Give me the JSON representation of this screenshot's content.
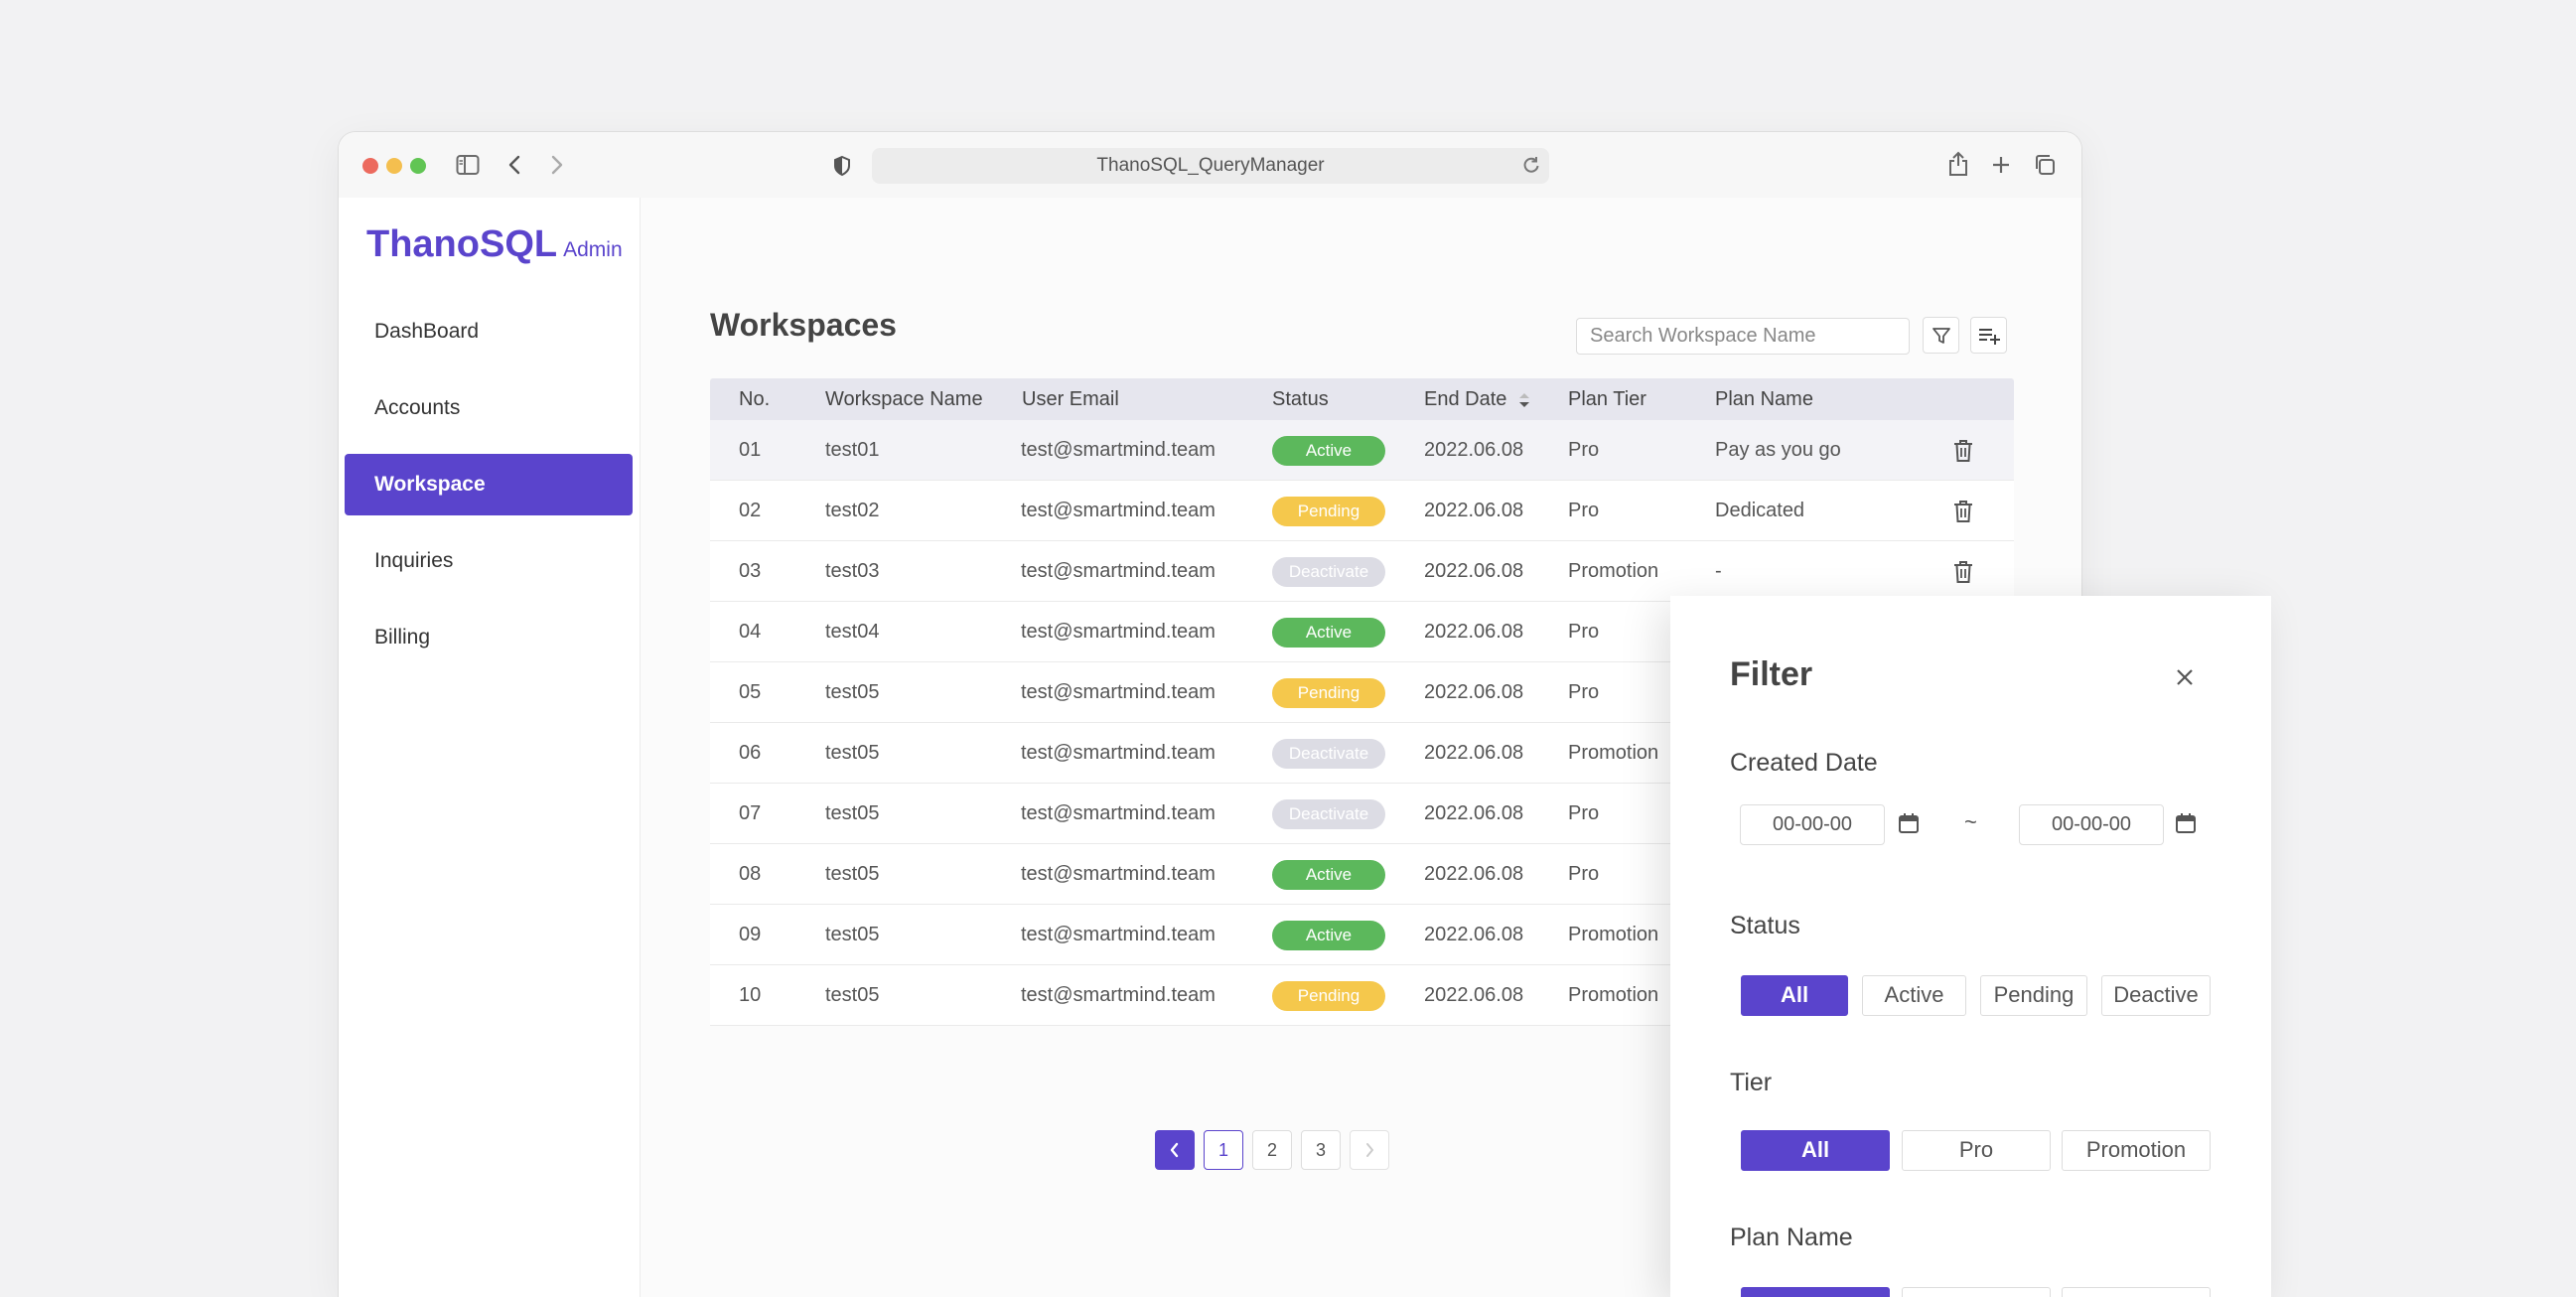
{
  "browser": {
    "url": "ThanoSQL_QueryManager"
  },
  "logo": {
    "main": "ThanoSQL",
    "sub": "Admin"
  },
  "sidebar": {
    "items": [
      {
        "label": "DashBoard"
      },
      {
        "label": "Accounts"
      },
      {
        "label": "Workspace"
      },
      {
        "label": "Inquiries"
      },
      {
        "label": "Billing"
      }
    ],
    "active": "Workspace"
  },
  "page": {
    "title": "Workspaces",
    "search_placeholder": "Search Workspace Name"
  },
  "table": {
    "headers": {
      "no": "No.",
      "name": "Workspace Name",
      "email": "User Email",
      "status": "Status",
      "end_date": "End Date",
      "tier": "Plan Tier",
      "plan": "Plan Name"
    },
    "rows": [
      {
        "no": "01",
        "name": "test01",
        "email": "test@smartmind.team",
        "status": "Active",
        "end_date": "2022.06.08",
        "tier": "Pro",
        "plan": "Pay as you go"
      },
      {
        "no": "02",
        "name": "test02",
        "email": "test@smartmind.team",
        "status": "Pending",
        "end_date": "2022.06.08",
        "tier": "Pro",
        "plan": "Dedicated"
      },
      {
        "no": "03",
        "name": "test03",
        "email": "test@smartmind.team",
        "status": "Deactivate",
        "end_date": "2022.06.08",
        "tier": "Promotion",
        "plan": "-"
      },
      {
        "no": "04",
        "name": "test04",
        "email": "test@smartmind.team",
        "status": "Active",
        "end_date": "2022.06.08",
        "tier": "Pro",
        "plan": ""
      },
      {
        "no": "05",
        "name": "test05",
        "email": "test@smartmind.team",
        "status": "Pending",
        "end_date": "2022.06.08",
        "tier": "Pro",
        "plan": ""
      },
      {
        "no": "06",
        "name": "test05",
        "email": "test@smartmind.team",
        "status": "Deactivate",
        "end_date": "2022.06.08",
        "tier": "Promotion",
        "plan": ""
      },
      {
        "no": "07",
        "name": "test05",
        "email": "test@smartmind.team",
        "status": "Deactivate",
        "end_date": "2022.06.08",
        "tier": "Pro",
        "plan": ""
      },
      {
        "no": "08",
        "name": "test05",
        "email": "test@smartmind.team",
        "status": "Active",
        "end_date": "2022.06.08",
        "tier": "Pro",
        "plan": ""
      },
      {
        "no": "09",
        "name": "test05",
        "email": "test@smartmind.team",
        "status": "Active",
        "end_date": "2022.06.08",
        "tier": "Promotion",
        "plan": ""
      },
      {
        "no": "10",
        "name": "test05",
        "email": "test@smartmind.team",
        "status": "Pending",
        "end_date": "2022.06.08",
        "tier": "Promotion",
        "plan": ""
      }
    ]
  },
  "pagination": {
    "pages": [
      "1",
      "2",
      "3"
    ],
    "current": "1"
  },
  "filter": {
    "title": "Filter",
    "created_date": {
      "label": "Created Date",
      "from": "00-00-00",
      "separator": "~",
      "to": "00-00-00"
    },
    "status": {
      "label": "Status",
      "options": [
        "All",
        "Active",
        "Pending",
        "Deactive"
      ],
      "selected": "All"
    },
    "tier": {
      "label": "Tier",
      "options": [
        "All",
        "Pro",
        "Promotion"
      ],
      "selected": "All"
    },
    "plan_name": {
      "label": "Plan Name"
    }
  },
  "colors": {
    "accent": "#5a44cc",
    "active": "#5cb85c",
    "pending": "#f5c84c",
    "deactivate": "#dcdce4"
  }
}
